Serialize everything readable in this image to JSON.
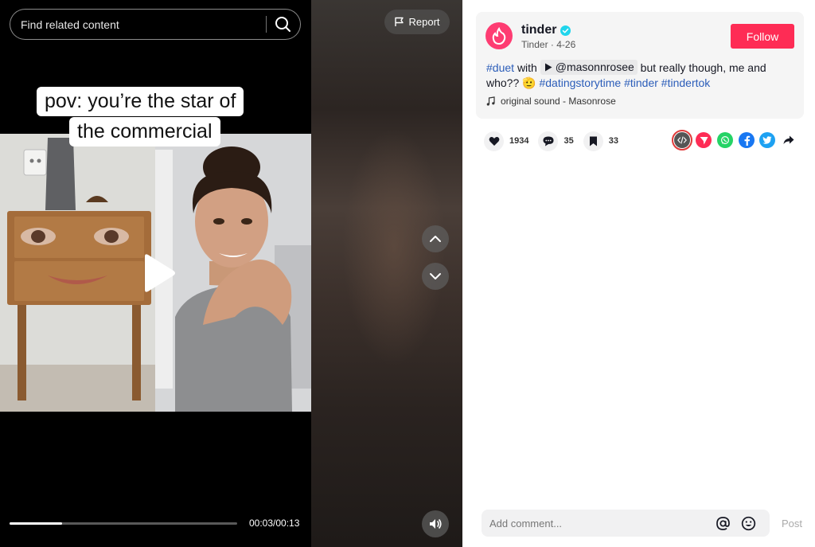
{
  "player": {
    "search": {
      "placeholder": "Find related content",
      "icon": "search-icon"
    },
    "report_label": "Report",
    "caption": [
      "pov: you’re the star of",
      "the commercial"
    ],
    "progress": {
      "fraction": 0.23,
      "time": "00:03/00:13"
    },
    "icons": {
      "up": "chevron-up-icon",
      "down": "chevron-down-icon",
      "volume": "volume-icon",
      "play": "play-icon",
      "flag": "flag-icon"
    }
  },
  "post": {
    "username": "tinder",
    "display_name": "Tinder",
    "date": "4-26",
    "follow_label": "Follow",
    "description": {
      "tag_duet": "#duet",
      "with_text": "with",
      "mention": "@masonnrosee",
      "text_1": "but really though, me and who??",
      "emoji": "🫡",
      "tags": [
        "#datingstorytime",
        "#tinder",
        "#tindertok"
      ]
    },
    "music": "original sound - Masonrose",
    "stats": {
      "likes": "1934",
      "comments": "35",
      "saves": "33"
    },
    "colors": {
      "accent": "#fe2c55",
      "tag": "#2b5db9",
      "brand": "#fe3c72"
    }
  },
  "comment": {
    "placeholder": "Add comment...",
    "post_label": "Post"
  }
}
